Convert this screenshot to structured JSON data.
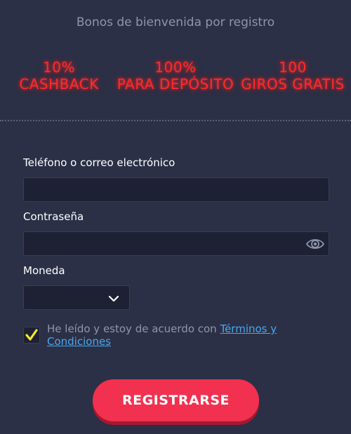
{
  "header": {
    "title": "Bonos de bienvenida por registro"
  },
  "bonuses": [
    {
      "value": "10%",
      "label": "CASHBACK"
    },
    {
      "value": "100%",
      "label": "PARA DEPÓSITO"
    },
    {
      "value": "100",
      "label": "GIROS GRATIS"
    }
  ],
  "form": {
    "contact": {
      "label": "Teléfono o correo electrónico",
      "value": ""
    },
    "password": {
      "label": "Contraseña",
      "value": ""
    },
    "currency": {
      "label": "Moneda",
      "value": ""
    },
    "terms": {
      "checked": true,
      "text": "He leído y estoy de acuerdo con ",
      "link": "Términos y Condiciones"
    },
    "submit_label": "REGISTRARSE"
  },
  "colors": {
    "background": "#2b3046",
    "neon": "#ff2a2a",
    "button": "#f2304f",
    "link": "#49a7ef",
    "checkbox": "#f5e62b"
  },
  "icons": {
    "password_toggle": "eye-icon",
    "currency_dropdown": "chevron-down-icon",
    "terms_checkbox": "checkmark-icon"
  }
}
